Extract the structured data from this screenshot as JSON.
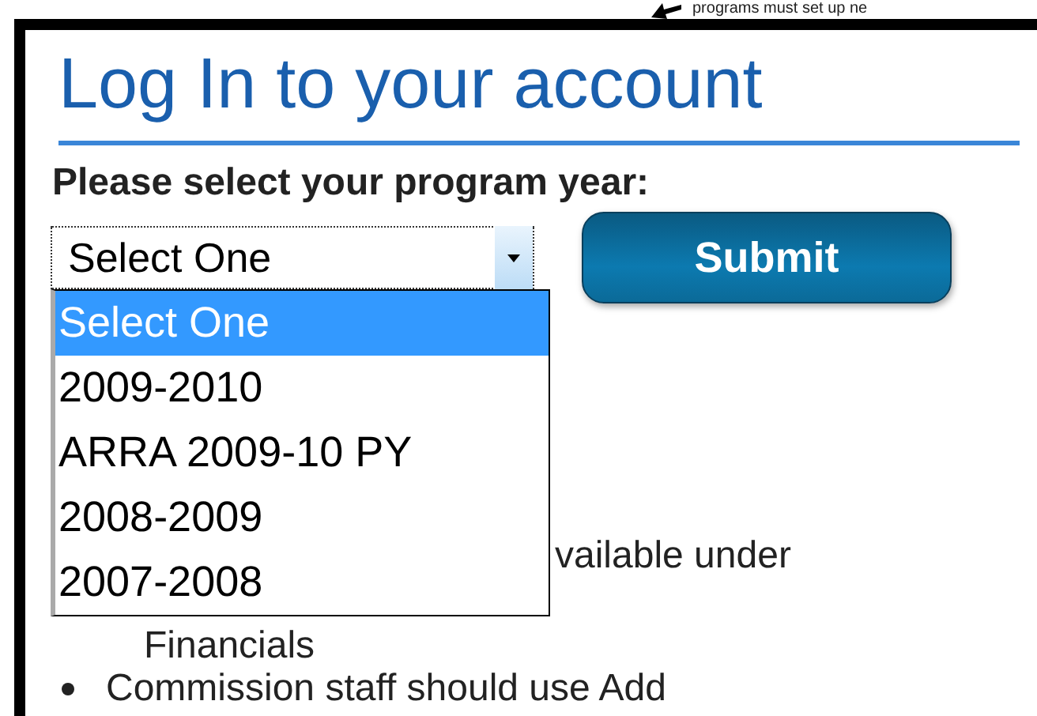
{
  "annotation": {
    "text": "programs must set up ne"
  },
  "heading": "Log In to your account",
  "prompt": "Please select your program year:",
  "select": {
    "value": "Select One",
    "expanded": true,
    "options": [
      {
        "label": "Select One",
        "selected": true
      },
      {
        "label": "2009-2010",
        "selected": false
      },
      {
        "label": "ARRA 2009-10 PY",
        "selected": false
      },
      {
        "label": "2008-2009",
        "selected": false
      },
      {
        "label": "2007-2008",
        "selected": false
      }
    ]
  },
  "submit": "Submit",
  "bullets": [
    {
      "text": "vailable under",
      "bullet": false
    },
    {
      "text": "Financials",
      "bullet": false
    },
    {
      "text": "Commission staff should use Add",
      "bullet": true
    }
  ]
}
